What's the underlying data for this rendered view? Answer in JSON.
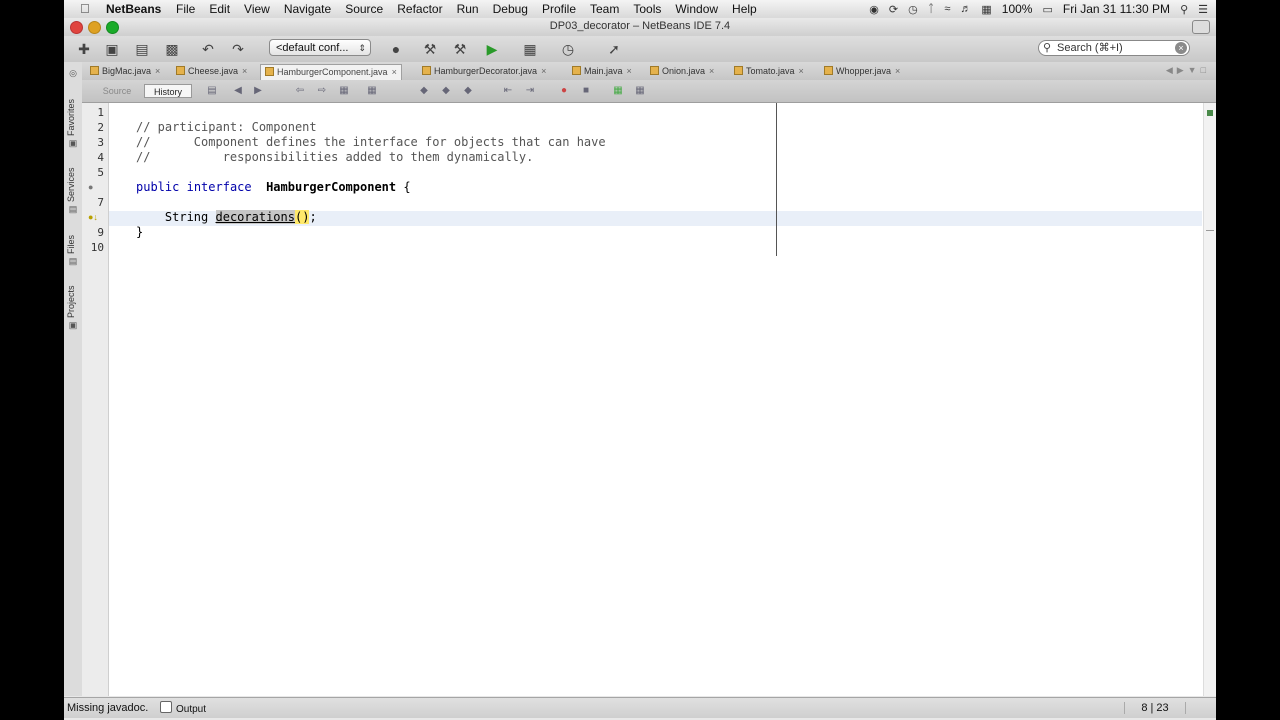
{
  "menubar": {
    "app_name": "NetBeans",
    "menus": [
      "File",
      "Edit",
      "View",
      "Navigate",
      "Source",
      "Refactor",
      "Run",
      "Debug",
      "Profile",
      "Team",
      "Tools",
      "Window",
      "Help"
    ],
    "battery": "100%",
    "clock": "Fri Jan 31  11:30 PM"
  },
  "window": {
    "title": "DP03_decorator – NetBeans IDE 7.4"
  },
  "toolbar": {
    "config_label": "<default conf...",
    "search_placeholder": "Search (⌘+I)"
  },
  "side_tabs": [
    "Favorites",
    "Services",
    "Files",
    "Projects"
  ],
  "tabs": [
    {
      "label": "BigMac.java",
      "active": false
    },
    {
      "label": "Cheese.java",
      "active": false
    },
    {
      "label": "HamburgerComponent.java",
      "active": true
    },
    {
      "label": "HamburgerDecorator.java",
      "active": false
    },
    {
      "label": "Main.java",
      "active": false
    },
    {
      "label": "Onion.java",
      "active": false
    },
    {
      "label": "Tomato.java",
      "active": false
    },
    {
      "label": "Whopper.java",
      "active": false
    }
  ],
  "editor_toolbar": {
    "source_label": "Source",
    "history_label": "History"
  },
  "editor": {
    "line_numbers": [
      "1",
      "2",
      "3",
      "4",
      "5",
      "6",
      "7",
      "8",
      "9",
      "10"
    ],
    "code": {
      "l2": "// participant: Component",
      "l3": "//      Component defines the interface for objects that can have",
      "l4": "//          responsibilities added to them dynamically.",
      "l6_kw1": "public",
      "l6_kw2": "interface",
      "l6_name": "HamburgerComponent",
      "l6_brace": "{",
      "l8_type": "String",
      "l8_method": "decorations",
      "l8_parens": "()",
      "l8_end": ";",
      "l9": "}"
    }
  },
  "statusbar": {
    "message": "Missing javadoc.",
    "output_label": "Output",
    "caret_position": "8 | 23"
  },
  "colors": {
    "keyword": "#0000aa",
    "selection_highlight": "#c6c6c6",
    "paren_match": "#ffe96b"
  }
}
